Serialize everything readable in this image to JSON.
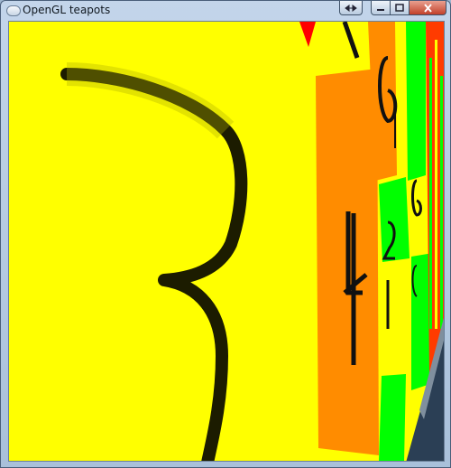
{
  "window": {
    "title": "OpenGL teapots",
    "icon": "app-window-icon",
    "controls": [
      {
        "name": "back",
        "icon": "double-arrow-icon"
      },
      {
        "name": "minimize",
        "icon": "minimize-icon"
      },
      {
        "name": "maximize",
        "icon": "maximize-icon"
      },
      {
        "name": "close",
        "icon": "close-icon"
      }
    ]
  },
  "scene": {
    "background": "#ffff00",
    "colors": {
      "yellow": "#ffff00",
      "orange": "#ff8c00",
      "green": "#00ff00",
      "red": "#ff0000",
      "sky": "#2b3f55"
    },
    "glyph_labels": [
      "3",
      "e",
      "4",
      "2",
      "e"
    ]
  }
}
